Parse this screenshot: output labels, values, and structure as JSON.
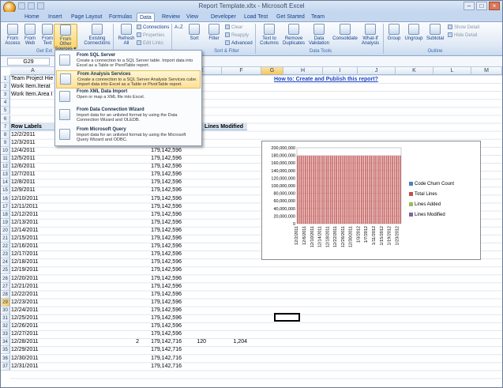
{
  "window": {
    "title": "Report Template.xltx - Microsoft Excel"
  },
  "tabs": [
    "Home",
    "Insert",
    "Page Layout",
    "Formulas",
    "Data",
    "Review",
    "View",
    "Developer",
    "Load Test",
    "Get Started",
    "Team"
  ],
  "ribbon": {
    "get_external": {
      "label": "Get Ext",
      "from_access": "From Access",
      "from_web": "From Web",
      "from_text": "From Text",
      "from_other": "From Other Sources",
      "existing": "Existing Connections"
    },
    "connections": {
      "refresh": "Refresh All",
      "connections": "Connections",
      "properties": "Properties",
      "edit_links": "Edit Links"
    },
    "sort_filter": {
      "label": "Sort & Filter",
      "sort_az": "A↓Z",
      "sort": "Sort",
      "filter": "Filter",
      "clear": "Clear",
      "reapply": "Reapply",
      "advanced": "Advanced"
    },
    "data_tools": {
      "label": "Data Tools",
      "text_to_columns": "Text to Columns",
      "remove_duplicates": "Remove Duplicates",
      "data_validation": "Data Validation",
      "consolidate": "Consolidate",
      "what_if": "What-If Analysis"
    },
    "outline": {
      "label": "Outline",
      "group": "Group",
      "ungroup": "Ungroup",
      "subtotal": "Subtotal",
      "show_detail": "Show Detail",
      "hide_detail": "Hide Detail"
    }
  },
  "formula_bar": {
    "name_box": "G29",
    "fx": "fx",
    "value": ""
  },
  "columns": [
    "A",
    "B",
    "C",
    "D",
    "E",
    "F",
    "G",
    "H",
    "I",
    "J",
    "K",
    "L",
    "M",
    "N"
  ],
  "rows": [
    "1",
    "2",
    "3",
    "4",
    "5",
    "6",
    "7",
    "8",
    "9",
    "10",
    "11",
    "12",
    "13",
    "14",
    "15",
    "16",
    "17",
    "18",
    "19",
    "20",
    "21",
    "22",
    "23",
    "24",
    "25",
    "26",
    "27",
    "28",
    "29",
    "30",
    "31",
    "32",
    "33",
    "34",
    "35",
    "36",
    "37"
  ],
  "sheet": {
    "filters": [
      "Team Project Hie",
      "Work Item.Iterat",
      "Work Item.Area I"
    ],
    "row_labels_header": "Row Labels",
    "lines_modified_header": "Lines Modified",
    "dates": [
      "12/2/2011",
      "12/3/2011",
      "12/4/2011",
      "12/5/2011",
      "12/6/2011",
      "12/7/2011",
      "12/8/2011",
      "12/9/2011",
      "12/10/2011",
      "12/11/2011",
      "12/12/2011",
      "12/13/2011",
      "12/14/2011",
      "12/15/2011",
      "12/16/2011",
      "12/17/2011",
      "12/18/2011",
      "12/19/2011",
      "12/20/2011",
      "12/21/2011",
      "12/22/2011",
      "12/23/2011",
      "12/24/2011",
      "12/25/2011",
      "12/26/2011",
      "12/27/2011",
      "12/28/2011",
      "12/29/2011",
      "12/30/2011",
      "12/31/2011"
    ],
    "total_lines": [
      "179,142,596",
      "179,142,596",
      "179,142,596",
      "179,142,596",
      "179,142,596",
      "179,142,596",
      "179,142,596",
      "179,142,596",
      "179,142,596",
      "179,142,596",
      "179,142,596",
      "179,142,596",
      "179,142,596",
      "179,142,596",
      "179,142,596",
      "179,142,596",
      "179,142,596",
      "179,142,596",
      "179,142,596",
      "179,142,596",
      "179,142,596",
      "179,142,596",
      "179,142,596",
      "179,142,596",
      "179,142,596",
      "179,142,596",
      "179,142,716",
      "179,142,716",
      "179,142,716",
      "179,142,716"
    ],
    "row33_code_churn": "2",
    "row33_lines_added": "120",
    "row33_lines_modified": "1,204",
    "howto_link": "How to: Create and Publish this report?"
  },
  "menu": {
    "items": [
      {
        "title": "From SQL Server",
        "desc": "Create a connection to a SQL Server table. Import data into Excel as a Table or PivotTable report."
      },
      {
        "title": "From Analysis Services",
        "desc": "Create a connection to a SQL Server Analysis Services cube. Import data into Excel as a Table or PivotTable report."
      },
      {
        "title": "From XML Data Import",
        "desc": "Open or map a XML file into Excel."
      },
      {
        "title": "From Data Connection Wizard",
        "desc": "Import data for an unlisted format by using the Data Connection Wizard and OLEDB."
      },
      {
        "title": "From Microsoft Query",
        "desc": "Import data for an unlisted format by using the Microsoft Query Wizard and ODBC."
      }
    ]
  },
  "chart_data": {
    "type": "bar",
    "categories": [
      "12/2/2011",
      "12/3/2011",
      "12/4/2011",
      "12/5/2011",
      "12/6/2011",
      "12/7/2011",
      "12/8/2011",
      "12/9/2011",
      "12/10/2011",
      "12/11/2011",
      "12/12/2011",
      "12/13/2011",
      "12/14/2011",
      "12/15/2011",
      "12/16/2011",
      "12/17/2011",
      "12/18/2011",
      "12/19/2011",
      "12/20/2011",
      "12/21/2011",
      "12/22/2011",
      "12/23/2011",
      "12/24/2011",
      "12/25/2011",
      "12/26/2011",
      "12/27/2011",
      "12/28/2011",
      "12/29/2011",
      "12/30/2011",
      "12/31/2011",
      "1/1/2012",
      "1/2/2012",
      "1/3/2012",
      "1/4/2012",
      "1/5/2012",
      "1/6/2012",
      "1/7/2012",
      "1/8/2012",
      "1/9/2012",
      "1/10/2012",
      "1/11/2012",
      "1/12/2012",
      "1/13/2012",
      "1/14/2012",
      "1/15/2012",
      "1/16/2012",
      "1/17/2012",
      "1/18/2012",
      "1/19/2012",
      "1/20/2012",
      "1/21/2012",
      "1/22/2012",
      "1/23/2012",
      "1/24/2012"
    ],
    "tick_labels": [
      "12/2/2011",
      "12/6/2011",
      "12/10/2011",
      "12/14/2011",
      "12/18/2011",
      "12/22/2011",
      "12/26/2011",
      "12/30/2011",
      "1/3/2012",
      "1/7/2012",
      "1/11/2012",
      "1/15/2012",
      "1/19/2012",
      "1/23/2012"
    ],
    "series": [
      {
        "name": "Code Churn Count",
        "color": "#4f81bd",
        "value": 0
      },
      {
        "name": "Total Lines",
        "color": "#c0504d",
        "value": 179142596
      },
      {
        "name": "Lines Added",
        "color": "#9bbb59",
        "value": 0
      },
      {
        "name": "Lines Modified",
        "color": "#8064a2",
        "value": 0
      }
    ],
    "y_ticks": [
      "200,000,000",
      "180,000,000",
      "160,000,000",
      "140,000,000",
      "120,000,000",
      "100,000,000",
      "80,000,000",
      "60,000,000",
      "40,000,000",
      "20,000,000",
      "0"
    ],
    "ylim": [
      0,
      200000000
    ],
    "legend_position": "right"
  }
}
